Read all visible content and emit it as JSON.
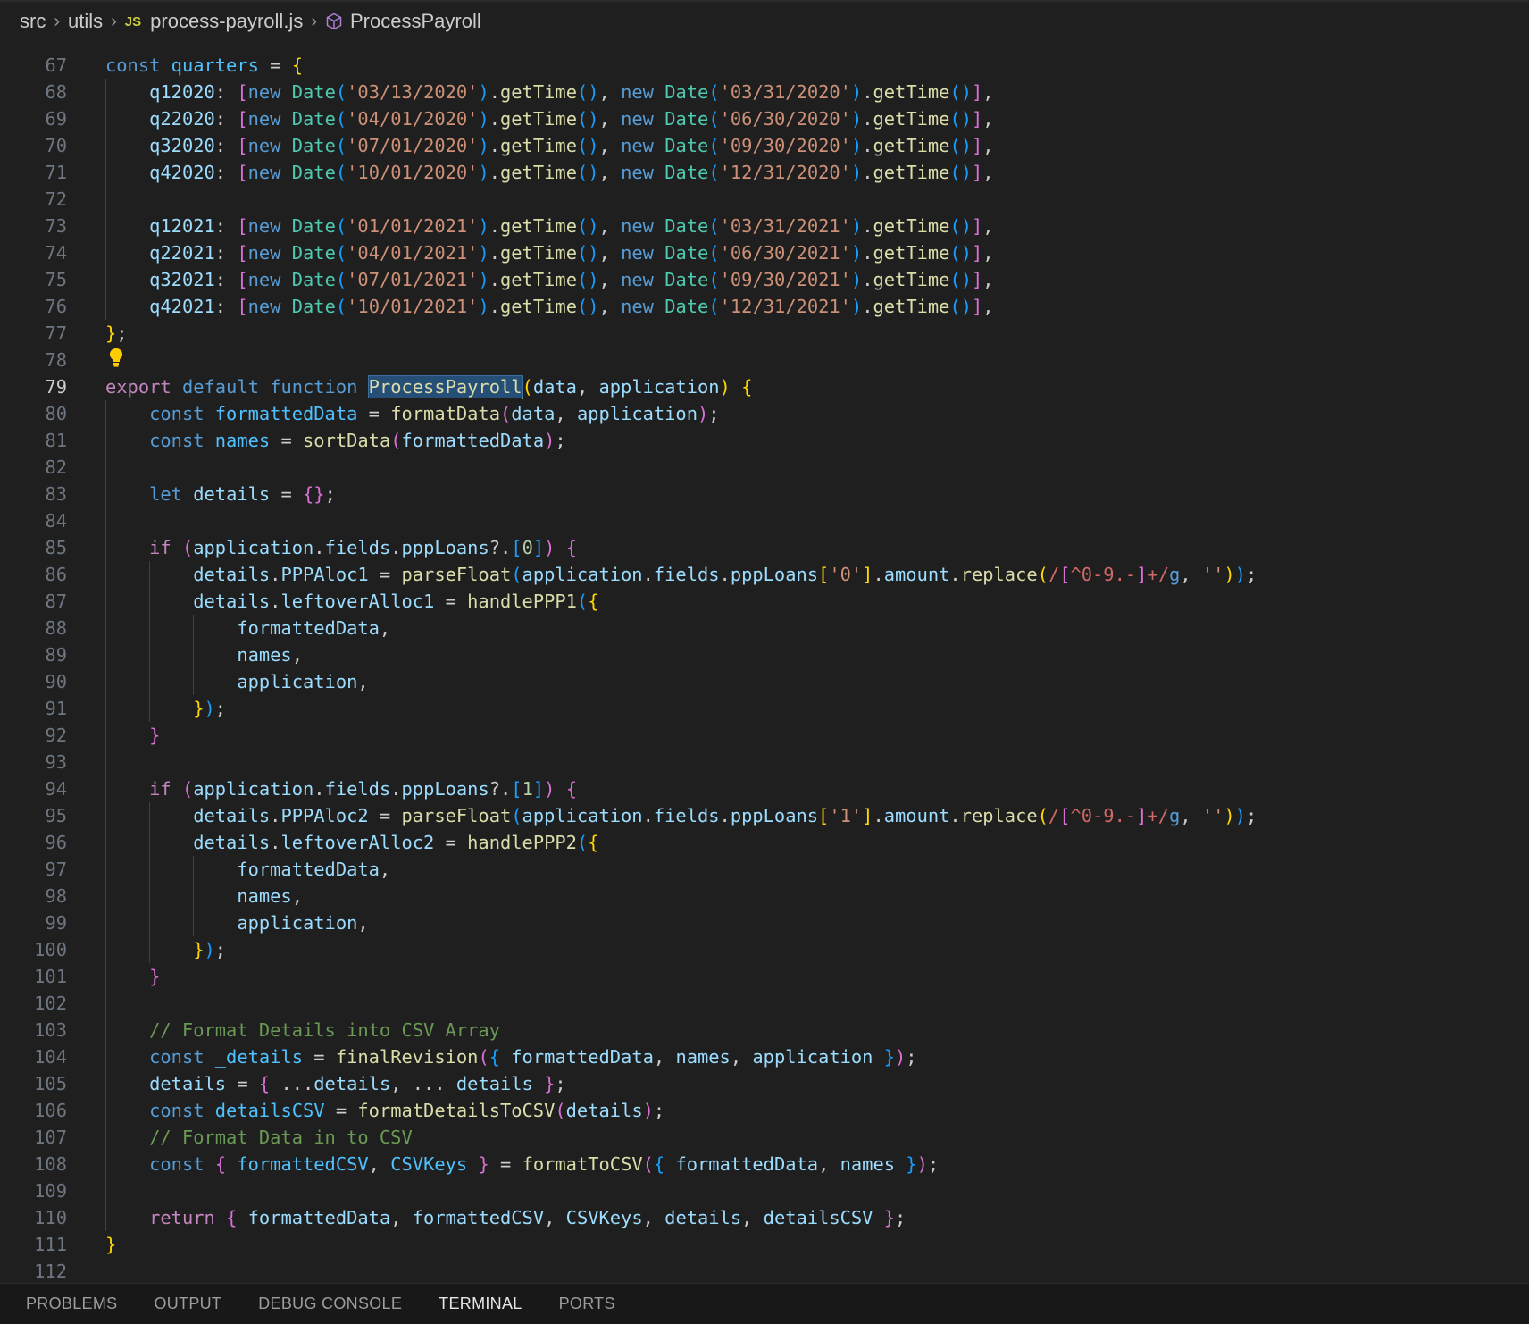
{
  "breadcrumb": {
    "folder1": "src",
    "folder2": "utils",
    "file_icon": "JS",
    "file": "process-payroll.js",
    "symbol": "ProcessPayroll"
  },
  "editor": {
    "active_line": 79,
    "highlighted_symbol": "ProcessPayroll",
    "lightbulb_line": 78,
    "lines": [
      {
        "n": 67,
        "text": "const quarters = {"
      },
      {
        "n": 68,
        "text": "    q12020: [new Date('03/13/2020').getTime(), new Date('03/31/2020').getTime()],"
      },
      {
        "n": 69,
        "text": "    q22020: [new Date('04/01/2020').getTime(), new Date('06/30/2020').getTime()],"
      },
      {
        "n": 70,
        "text": "    q32020: [new Date('07/01/2020').getTime(), new Date('09/30/2020').getTime()],"
      },
      {
        "n": 71,
        "text": "    q42020: [new Date('10/01/2020').getTime(), new Date('12/31/2020').getTime()],"
      },
      {
        "n": 72,
        "text": ""
      },
      {
        "n": 73,
        "text": "    q12021: [new Date('01/01/2021').getTime(), new Date('03/31/2021').getTime()],"
      },
      {
        "n": 74,
        "text": "    q22021: [new Date('04/01/2021').getTime(), new Date('06/30/2021').getTime()],"
      },
      {
        "n": 75,
        "text": "    q32021: [new Date('07/01/2021').getTime(), new Date('09/30/2021').getTime()],"
      },
      {
        "n": 76,
        "text": "    q42021: [new Date('10/01/2021').getTime(), new Date('12/31/2021').getTime()],"
      },
      {
        "n": 77,
        "text": "};"
      },
      {
        "n": 78,
        "text": ""
      },
      {
        "n": 79,
        "text": "export default function ProcessPayroll(data, application) {"
      },
      {
        "n": 80,
        "text": "    const formattedData = formatData(data, application);"
      },
      {
        "n": 81,
        "text": "    const names = sortData(formattedData);"
      },
      {
        "n": 82,
        "text": ""
      },
      {
        "n": 83,
        "text": "    let details = {};"
      },
      {
        "n": 84,
        "text": ""
      },
      {
        "n": 85,
        "text": "    if (application.fields.pppLoans?.[0]) {"
      },
      {
        "n": 86,
        "text": "        details.PPPAloc1 = parseFloat(application.fields.pppLoans['0'].amount.replace(/[^0-9.-]+/g, ''));"
      },
      {
        "n": 87,
        "text": "        details.leftoverAlloc1 = handlePPP1({"
      },
      {
        "n": 88,
        "text": "            formattedData,"
      },
      {
        "n": 89,
        "text": "            names,"
      },
      {
        "n": 90,
        "text": "            application,"
      },
      {
        "n": 91,
        "text": "        });"
      },
      {
        "n": 92,
        "text": "    }"
      },
      {
        "n": 93,
        "text": ""
      },
      {
        "n": 94,
        "text": "    if (application.fields.pppLoans?.[1]) {"
      },
      {
        "n": 95,
        "text": "        details.PPPAloc2 = parseFloat(application.fields.pppLoans['1'].amount.replace(/[^0-9.-]+/g, ''));"
      },
      {
        "n": 96,
        "text": "        details.leftoverAlloc2 = handlePPP2({"
      },
      {
        "n": 97,
        "text": "            formattedData,"
      },
      {
        "n": 98,
        "text": "            names,"
      },
      {
        "n": 99,
        "text": "            application,"
      },
      {
        "n": 100,
        "text": "        });"
      },
      {
        "n": 101,
        "text": "    }"
      },
      {
        "n": 102,
        "text": ""
      },
      {
        "n": 103,
        "text": "    // Format Details into CSV Array"
      },
      {
        "n": 104,
        "text": "    const _details = finalRevision({ formattedData, names, application });"
      },
      {
        "n": 105,
        "text": "    details = { ...details, ..._details };"
      },
      {
        "n": 106,
        "text": "    const detailsCSV = formatDetailsToCSV(details);"
      },
      {
        "n": 107,
        "text": "    // Format Data in to CSV"
      },
      {
        "n": 108,
        "text": "    const { formattedCSV, CSVKeys } = formatToCSV({ formattedData, names });"
      },
      {
        "n": 109,
        "text": ""
      },
      {
        "n": 110,
        "text": "    return { formattedData, formattedCSV, CSVKeys, details, detailsCSV };"
      },
      {
        "n": 111,
        "text": "}"
      },
      {
        "n": 112,
        "text": ""
      }
    ]
  },
  "panel": {
    "tabs": [
      "PROBLEMS",
      "OUTPUT",
      "DEBUG CONSOLE",
      "TERMINAL",
      "PORTS"
    ],
    "active_tab": "TERMINAL"
  },
  "colors": {
    "background": "#1f1f1f",
    "keyword": "#569cd6",
    "control": "#c586c0",
    "string": "#ce9178",
    "function": "#dcdcaa",
    "class": "#4ec9b0",
    "variable": "#9cdcfe",
    "comment": "#6a9955",
    "selection": "#264f78"
  }
}
